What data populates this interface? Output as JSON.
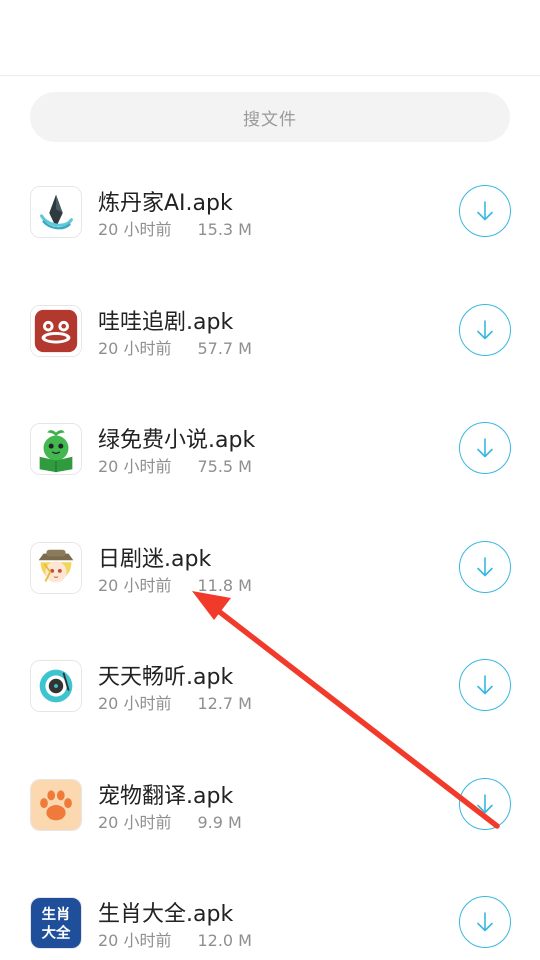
{
  "search": {
    "placeholder": "搜文件"
  },
  "files": [
    {
      "name": "炼丹家AI.apk",
      "time": "20 小时前",
      "size": "15.3 M",
      "icon": "liandanjia-logo-icon"
    },
    {
      "name": "哇哇追剧.apk",
      "time": "20 小时前",
      "size": "57.7 M",
      "icon": "wawa-face-icon"
    },
    {
      "name": "绿免费小说.apk",
      "time": "20 小时前",
      "size": "75.5 M",
      "icon": "green-book-mascot-icon"
    },
    {
      "name": "日剧迷.apk",
      "time": "20 小时前",
      "size": "11.8 M",
      "icon": "anime-girl-icon"
    },
    {
      "name": "天天畅听.apk",
      "time": "20 小时前",
      "size": "12.7 M",
      "icon": "vinyl-record-icon"
    },
    {
      "name": "宠物翻译.apk",
      "time": "20 小时前",
      "size": "9.9 M",
      "icon": "paw-icon"
    },
    {
      "name": "生肖大全.apk",
      "time": "20 小时前",
      "size": "12.0 M",
      "icon": "shengxiao-daquan-icon",
      "icon_text": [
        "生肖",
        "大全"
      ]
    }
  ],
  "colors": {
    "accent": "#39b8e0",
    "annotation_arrow": "#f23a2a"
  }
}
